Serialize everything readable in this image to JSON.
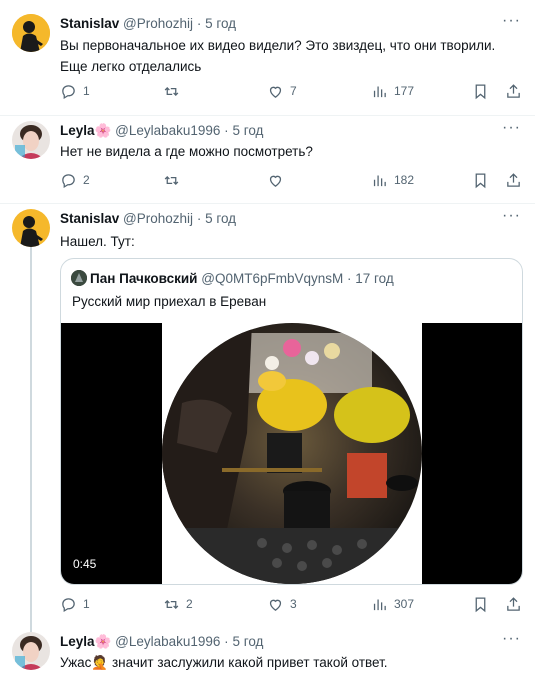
{
  "tweets": [
    {
      "author": "Stanislav",
      "handle": "@Prohozhij",
      "dot": "·",
      "time": "5 год",
      "text_lines": [
        "Вы первоначальное их видео видели? Это звиздец, что они творили.",
        "Еще легко отделались"
      ],
      "replies": "1",
      "retweets": "",
      "likes": "7",
      "views": "177"
    },
    {
      "author": "Leyla",
      "handle": "@Leylabaku1996",
      "dot": "·",
      "time": "5 год",
      "text_lines": [
        "Нет не видела а где можно посмотреть?"
      ],
      "replies": "2",
      "retweets": "",
      "likes": "",
      "views": "182"
    },
    {
      "author": "Stanislav",
      "handle": "@Prohozhij",
      "dot": "·",
      "time": "5 год",
      "text_lines": [
        "Нашел. Тут:"
      ],
      "replies": "1",
      "retweets": "2",
      "likes": "3",
      "views": "307",
      "quote": {
        "author": "Пан Пачковский",
        "handle": "@Q0MT6pFmbVqynsM",
        "dot": "·",
        "time": "17 год",
        "text": "Русский мир приехал в Ереван",
        "video_duration": "0:45"
      }
    },
    {
      "author": "Leyla",
      "handle": "@Leylabaku1996",
      "dot": "·",
      "time": "5 год",
      "text_lines": [
        "Ужас🤦 значит заслужили какой привет такой ответ."
      ]
    }
  ],
  "more_label": "···",
  "colors": {
    "text": "#0f1419",
    "secondary": "#536471",
    "border": "#cfd9de",
    "divider": "#eff3f4"
  },
  "icons": [
    "reply-icon",
    "retweet-icon",
    "like-icon",
    "views-icon",
    "bookmark-icon",
    "share-icon",
    "more-icon",
    "verified-flower-icon"
  ]
}
